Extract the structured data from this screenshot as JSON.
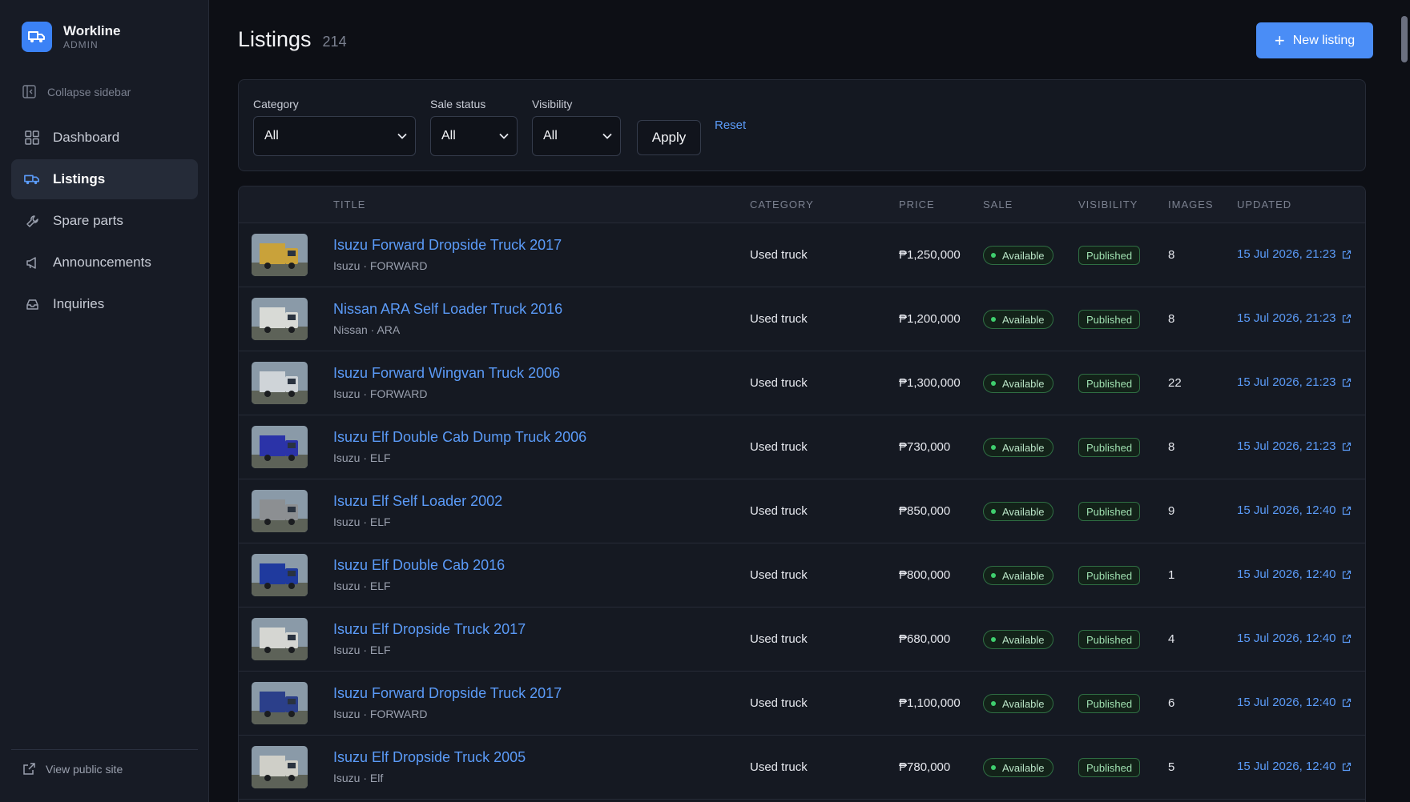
{
  "brand": {
    "name": "Workline",
    "sub": "ADMIN"
  },
  "sidebar": {
    "collapse_label": "Collapse sidebar",
    "items": [
      {
        "label": "Dashboard",
        "icon": "grid-icon"
      },
      {
        "label": "Listings",
        "icon": "truck-icon",
        "active": true
      },
      {
        "label": "Spare parts",
        "icon": "wrench-icon"
      },
      {
        "label": "Announcements",
        "icon": "megaphone-icon"
      },
      {
        "label": "Inquiries",
        "icon": "inbox-icon"
      }
    ],
    "view_public": "View public site"
  },
  "header": {
    "title": "Listings",
    "count": "214",
    "new_button": "New listing"
  },
  "filters": {
    "category": {
      "label": "Category",
      "value": "All"
    },
    "sale_status": {
      "label": "Sale status",
      "value": "All"
    },
    "visibility": {
      "label": "Visibility",
      "value": "All"
    },
    "apply": "Apply",
    "reset": "Reset"
  },
  "table": {
    "columns": [
      "TITLE",
      "CATEGORY",
      "PRICE",
      "SALE",
      "VISIBILITY",
      "IMAGES",
      "UPDATED"
    ],
    "rows": [
      {
        "title": "Isuzu Forward Dropside Truck 2017",
        "sub": "Isuzu · FORWARD",
        "category": "Used truck",
        "price": "₱1,250,000",
        "sale": "Available",
        "visibility": "Published",
        "images": "8",
        "updated": "15 Jul 2026, 21:23",
        "thumb_color": "#c9a23a"
      },
      {
        "title": "Nissan ARA Self Loader Truck 2016",
        "sub": "Nissan · ARA",
        "category": "Used truck",
        "price": "₱1,200,000",
        "sale": "Available",
        "visibility": "Published",
        "images": "8",
        "updated": "15 Jul 2026, 21:23",
        "thumb_color": "#d8dad6"
      },
      {
        "title": "Isuzu Forward Wingvan Truck 2006",
        "sub": "Isuzu · FORWARD",
        "category": "Used truck",
        "price": "₱1,300,000",
        "sale": "Available",
        "visibility": "Published",
        "images": "22",
        "updated": "15 Jul 2026, 21:23",
        "thumb_color": "#cfd4d8"
      },
      {
        "title": "Isuzu Elf Double Cab Dump Truck 2006",
        "sub": "Isuzu · ELF",
        "category": "Used truck",
        "price": "₱730,000",
        "sale": "Available",
        "visibility": "Published",
        "images": "8",
        "updated": "15 Jul 2026, 21:23",
        "thumb_color": "#2b33a8"
      },
      {
        "title": "Isuzu Elf Self Loader 2002",
        "sub": "Isuzu · ELF",
        "category": "Used truck",
        "price": "₱850,000",
        "sale": "Available",
        "visibility": "Published",
        "images": "9",
        "updated": "15 Jul 2026, 12:40",
        "thumb_color": "#8c8f92"
      },
      {
        "title": "Isuzu Elf Double Cab 2016",
        "sub": "Isuzu · ELF",
        "category": "Used truck",
        "price": "₱800,000",
        "sale": "Available",
        "visibility": "Published",
        "images": "1",
        "updated": "15 Jul 2026, 12:40",
        "thumb_color": "#1f3a9e"
      },
      {
        "title": "Isuzu Elf Dropside Truck 2017",
        "sub": "Isuzu · ELF",
        "category": "Used truck",
        "price": "₱680,000",
        "sale": "Available",
        "visibility": "Published",
        "images": "4",
        "updated": "15 Jul 2026, 12:40",
        "thumb_color": "#d5d6d2"
      },
      {
        "title": "Isuzu Forward Dropside Truck 2017",
        "sub": "Isuzu · FORWARD",
        "category": "Used truck",
        "price": "₱1,100,000",
        "sale": "Available",
        "visibility": "Published",
        "images": "6",
        "updated": "15 Jul 2026, 12:40",
        "thumb_color": "#2b3f8a"
      },
      {
        "title": "Isuzu Elf Dropside Truck 2005",
        "sub": "Isuzu · Elf",
        "category": "Used truck",
        "price": "₱780,000",
        "sale": "Available",
        "visibility": "Published",
        "images": "5",
        "updated": "15 Jul 2026, 12:40",
        "thumb_color": "#cfcfc8"
      }
    ]
  },
  "colors": {
    "accent": "#4a8df6",
    "link": "#5b9bf8",
    "success": "#3fcf6e",
    "bg": "#0d0f15",
    "sidebar": "#171b25"
  }
}
